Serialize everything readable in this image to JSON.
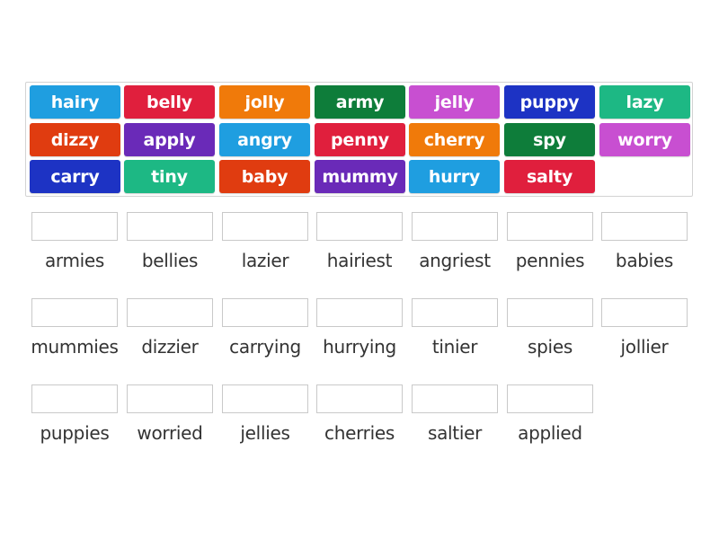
{
  "activity": {
    "type": "match-up",
    "tiles": [
      {
        "label": "hairy",
        "color": "#1f9ee0"
      },
      {
        "label": "belly",
        "color": "#e01f3d"
      },
      {
        "label": "jolly",
        "color": "#f07a0a"
      },
      {
        "label": "army",
        "color": "#0e7d3a"
      },
      {
        "label": "jelly",
        "color": "#c84fd1"
      },
      {
        "label": "puppy",
        "color": "#1d33c4"
      },
      {
        "label": "lazy",
        "color": "#1db884"
      },
      {
        "label": "dizzy",
        "color": "#e03c10"
      },
      {
        "label": "apply",
        "color": "#6a2ab8"
      },
      {
        "label": "angry",
        "color": "#1f9ee0"
      },
      {
        "label": "penny",
        "color": "#e01f3d"
      },
      {
        "label": "cherry",
        "color": "#f07a0a"
      },
      {
        "label": "spy",
        "color": "#0e7d3a"
      },
      {
        "label": "worry",
        "color": "#c84fd1"
      },
      {
        "label": "carry",
        "color": "#1d33c4"
      },
      {
        "label": "tiny",
        "color": "#1db884"
      },
      {
        "label": "baby",
        "color": "#e03c10"
      },
      {
        "label": "mummy",
        "color": "#6a2ab8"
      },
      {
        "label": "hurry",
        "color": "#1f9ee0"
      },
      {
        "label": "salty",
        "color": "#e01f3d"
      }
    ],
    "targets": [
      {
        "label": "armies",
        "value": ""
      },
      {
        "label": "bellies",
        "value": ""
      },
      {
        "label": "lazier",
        "value": ""
      },
      {
        "label": "hairiest",
        "value": ""
      },
      {
        "label": "angriest",
        "value": ""
      },
      {
        "label": "pennies",
        "value": ""
      },
      {
        "label": "babies",
        "value": ""
      },
      {
        "label": "mummies",
        "value": ""
      },
      {
        "label": "dizzier",
        "value": ""
      },
      {
        "label": "carrying",
        "value": ""
      },
      {
        "label": "hurrying",
        "value": ""
      },
      {
        "label": "tinier",
        "value": ""
      },
      {
        "label": "spies",
        "value": ""
      },
      {
        "label": "jollier",
        "value": ""
      },
      {
        "label": "puppies",
        "value": ""
      },
      {
        "label": "worried",
        "value": ""
      },
      {
        "label": "jellies",
        "value": ""
      },
      {
        "label": "cherries",
        "value": ""
      },
      {
        "label": "saltier",
        "value": ""
      },
      {
        "label": "applied",
        "value": ""
      }
    ]
  }
}
